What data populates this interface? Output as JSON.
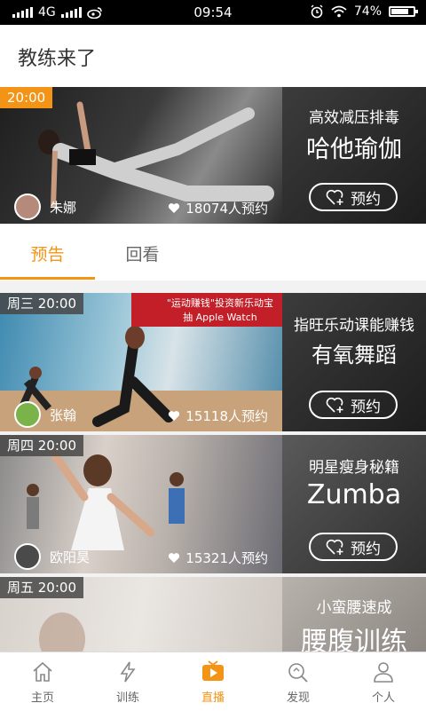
{
  "status_bar": {
    "network": "4G",
    "time": "09:54",
    "battery": "74%"
  },
  "header": {
    "title": "教练来了"
  },
  "featured": {
    "time": "20:00",
    "coach": "朱娜",
    "likes": "18074人预约",
    "promo_sub": "高效减压排毒",
    "promo_main": "哈他瑜伽",
    "book_label": "预约"
  },
  "tabs": [
    {
      "label": "预告"
    },
    {
      "label": "回看"
    }
  ],
  "schedule": [
    {
      "time": "周三 20:00",
      "banner_line1": "\"运动赚钱\"投资新乐动宝",
      "banner_line2": "抽 Apple Watch",
      "coach": "张翰",
      "likes": "15118人预约",
      "promo_sub": "指旺乐动课能赚钱",
      "promo_main": "有氧舞蹈",
      "book_label": "预约"
    },
    {
      "time": "周四 20:00",
      "coach": "欧阳昊",
      "likes": "15321人预约",
      "promo_sub": "明星瘦身秘籍",
      "promo_main": "Zumba",
      "book_label": "预约"
    },
    {
      "time": "周五 20:00",
      "promo_sub": "小蛮腰速成",
      "promo_main": "腰腹训练"
    }
  ],
  "bottom_nav": [
    {
      "label": "主页",
      "icon": "home-icon"
    },
    {
      "label": "训练",
      "icon": "lightning-icon"
    },
    {
      "label": "直播",
      "icon": "tv-play-icon"
    },
    {
      "label": "发现",
      "icon": "discover-icon"
    },
    {
      "label": "个人",
      "icon": "person-icon"
    }
  ],
  "colors": {
    "accent": "#f39417"
  }
}
